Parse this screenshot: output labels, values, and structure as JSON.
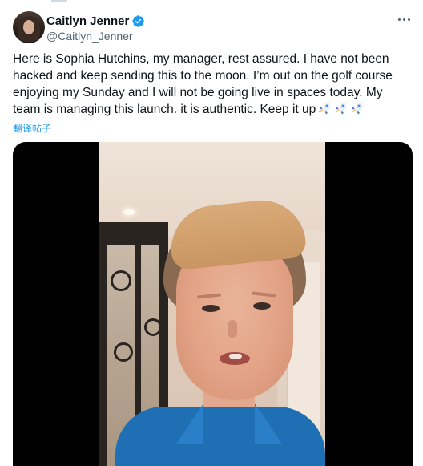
{
  "tweet": {
    "author": {
      "display_name": "Caitlyn Jenner",
      "handle": "@Caitlyn_Jenner",
      "verified": true,
      "verified_color": "#1d9bf0"
    },
    "text": "Here is Sophia Hutchins, my manager, rest assured. I have not been hacked and keep sending this to the moon. I’m out on the golf course enjoying my Sunday and I will not be going live in spaces today. My team is managing this launch. it is authentic. Keep it up",
    "emojis": [
      "rocket-icon",
      "rocket-icon",
      "rocket-icon"
    ],
    "translate_label": "翻译帖子",
    "media": {
      "type": "video",
      "background_color": "#000000"
    }
  },
  "colors": {
    "text_primary": "#0f1419",
    "text_secondary": "#536471",
    "link": "#1d9bf0"
  }
}
